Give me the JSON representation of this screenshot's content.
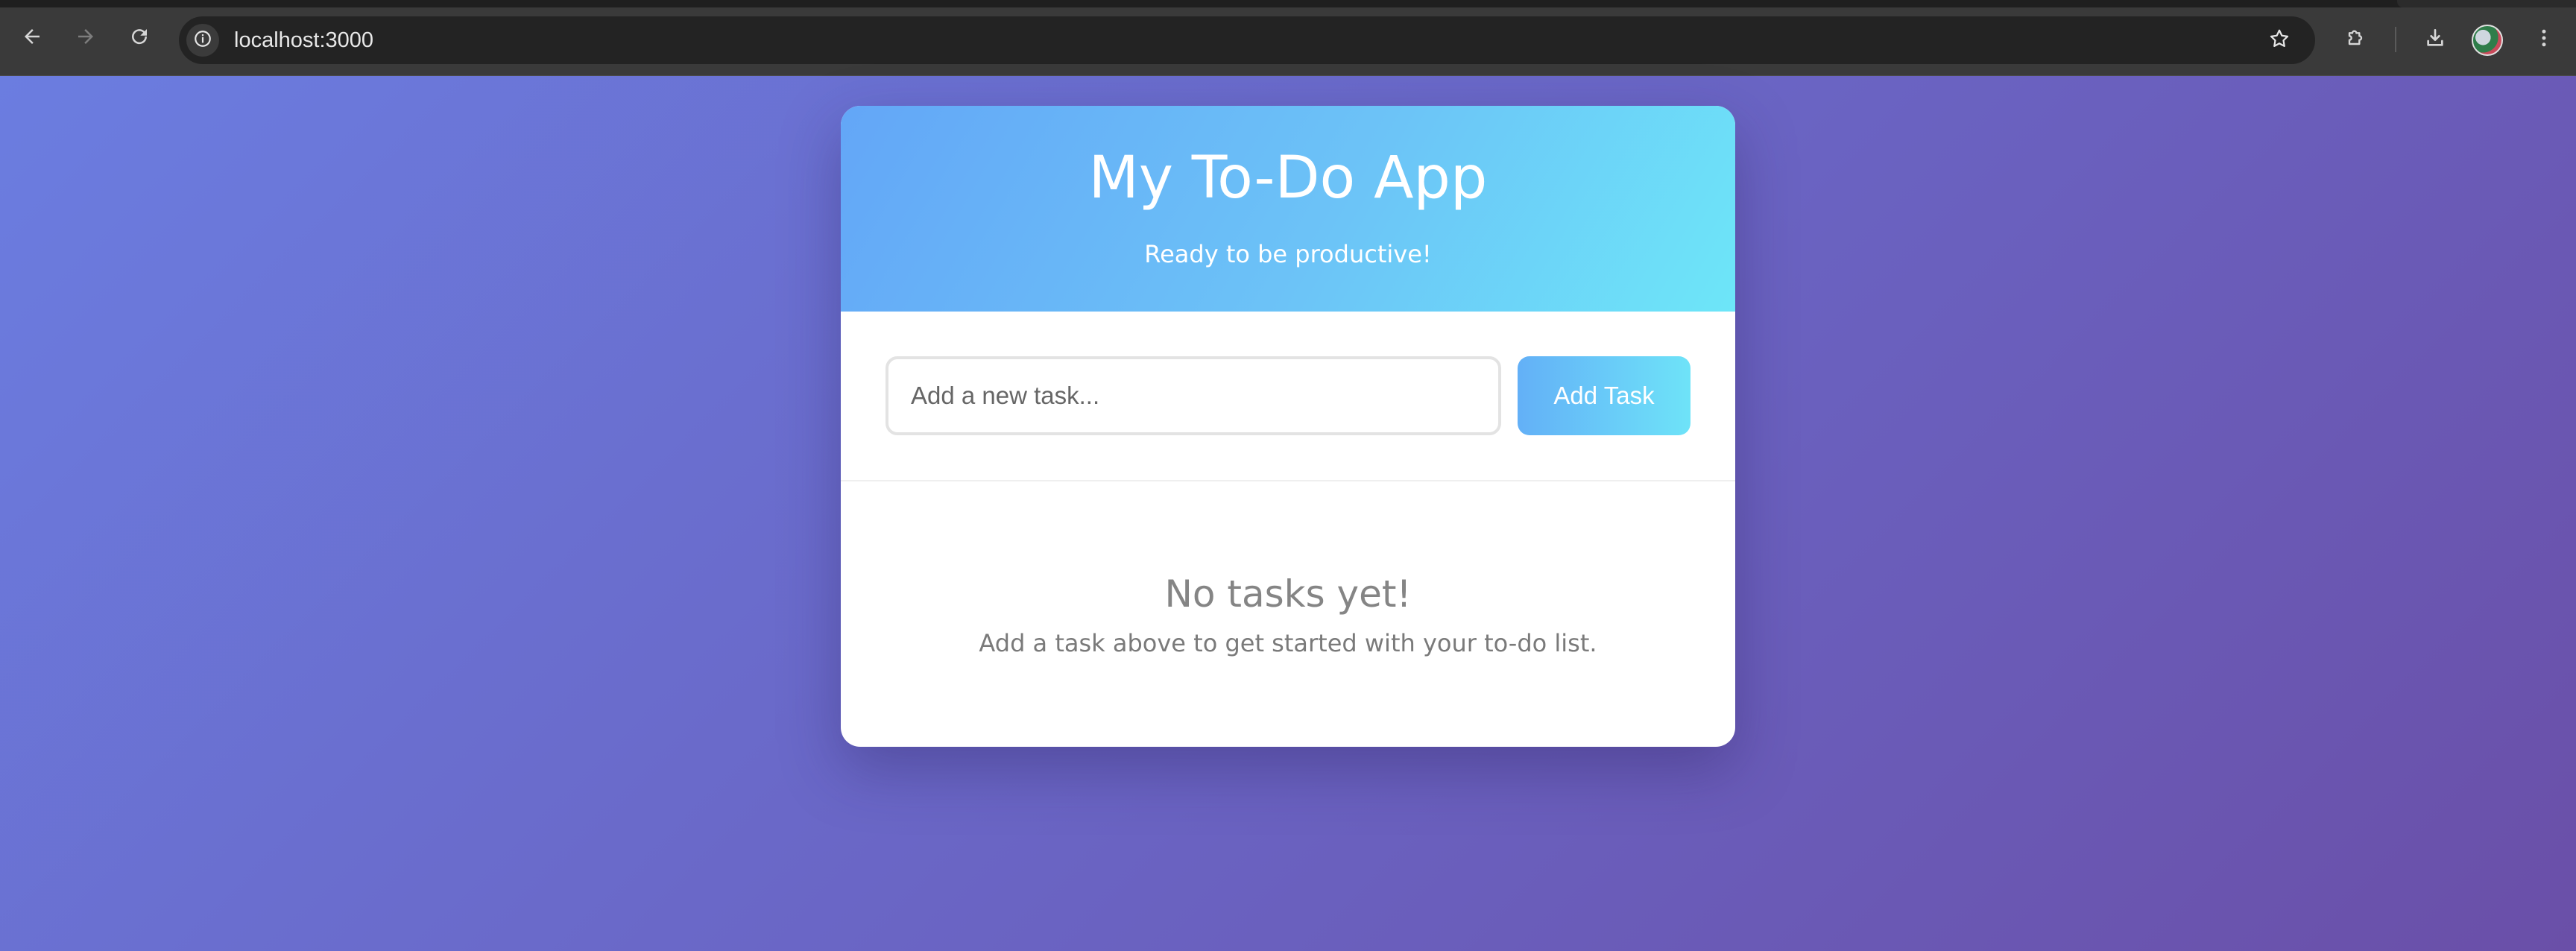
{
  "browser": {
    "url": "localhost:3000",
    "icons": {
      "back": "arrow-left-icon",
      "forward": "arrow-right-icon",
      "reload": "reload-icon",
      "site_info": "info-icon",
      "bookmark": "star-icon",
      "extensions": "puzzle-icon",
      "downloads": "download-icon",
      "profile": "avatar",
      "menu": "kebab-menu-icon"
    }
  },
  "app": {
    "title": "My To-Do App",
    "subtitle": "Ready to be productive!"
  },
  "form": {
    "placeholder": "Add a new task...",
    "value": "",
    "add_button_label": "Add Task"
  },
  "empty_state": {
    "title": "No tasks yet!",
    "description": "Add a task above to get started with your to-do list."
  },
  "colors": {
    "page_gradient_start": "#6b7de0",
    "page_gradient_end": "#6a4fa8",
    "header_gradient_start": "#63a6f7",
    "header_gradient_end": "#6de6f8",
    "button_gradient_start": "#63b0f7",
    "button_gradient_end": "#6ee3f8"
  }
}
